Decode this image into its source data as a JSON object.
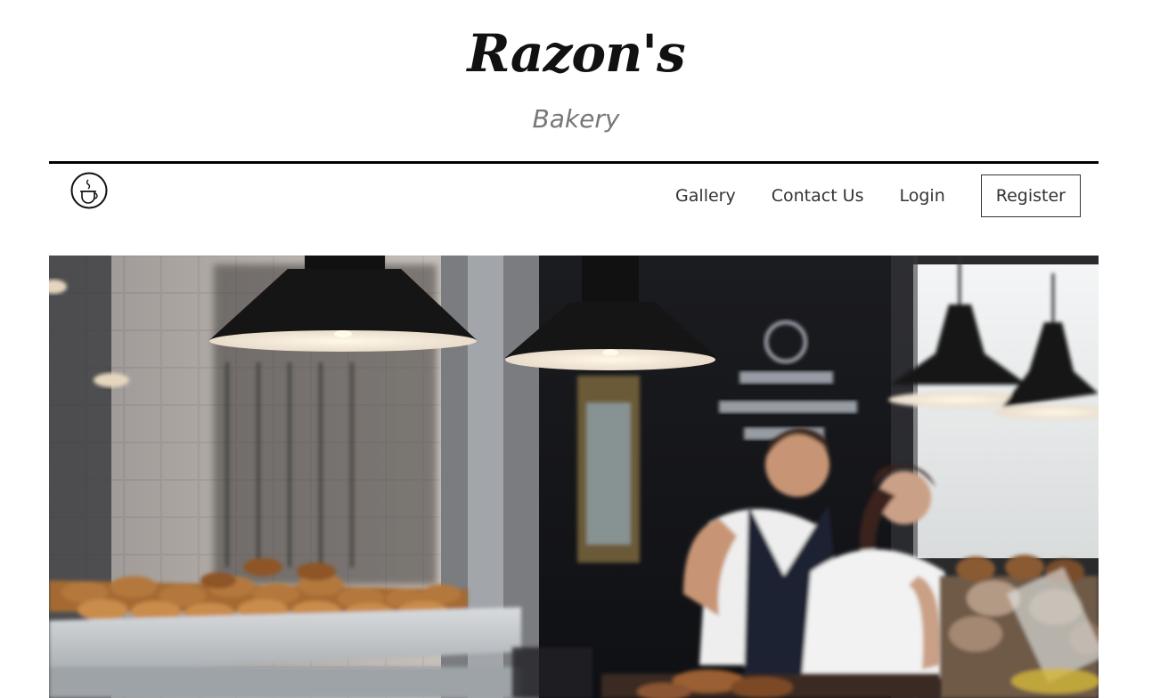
{
  "brand": {
    "title": "Razon's",
    "subtitle": "Bakery"
  },
  "nav": {
    "logo_icon": "coffee-cup-icon",
    "items": [
      {
        "label": "Gallery"
      },
      {
        "label": "Contact Us"
      },
      {
        "label": "Login"
      }
    ],
    "register_label": "Register"
  },
  "hero": {
    "image_subject": "bakery-interior-photo"
  },
  "colors": {
    "text_dark": "#333333",
    "subtitle_gray": "#777777",
    "divider": "#000000"
  }
}
